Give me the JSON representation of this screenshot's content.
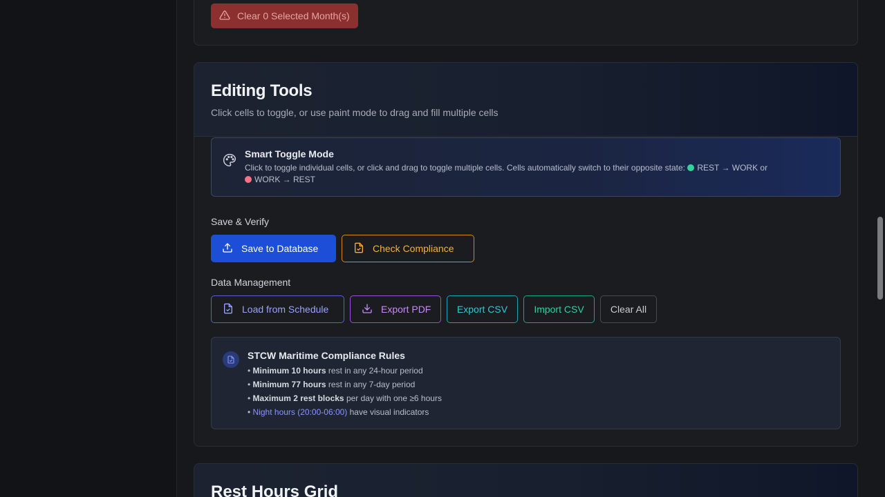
{
  "top_card": {
    "clear_months_label": "Clear 0 Selected Month(s)"
  },
  "editing_tools": {
    "title": "Editing Tools",
    "subtitle": "Click cells to toggle, or use paint mode to drag and fill multiple cells",
    "smart_toggle": {
      "title": "Smart Toggle Mode",
      "text_intro": "Click to toggle individual cells, or click and drag to toggle multiple cells. Cells automatically switch to their opposite state:",
      "rest_to_work": "REST → WORK or",
      "work_to_rest": "WORK → REST"
    },
    "save_verify": {
      "label": "Save & Verify",
      "save_button": "Save to Database",
      "check_button": "Check Compliance"
    },
    "data_management": {
      "label": "Data Management",
      "load_button": "Load from Schedule",
      "export_pdf_button": "Export PDF",
      "export_csv_button": "Export CSV",
      "import_csv_button": "Import CSV",
      "clear_all_button": "Clear All"
    },
    "rules": {
      "title": "STCW Maritime Compliance Rules",
      "items": [
        {
          "bold": "Minimum 10 hours",
          "rest": " rest in any 24-hour period"
        },
        {
          "bold": "Minimum 77 hours",
          "rest": " rest in any 7-day period"
        },
        {
          "bold": "Maximum 2 rest blocks",
          "rest": " per day with one ≥6 hours"
        },
        {
          "highlight": "Night hours (20:00-06:00)",
          "rest": " have visual indicators"
        }
      ]
    }
  },
  "rest_grid": {
    "title": "Rest Hours Grid"
  },
  "colors": {
    "primary": "#1d4ed8",
    "warning": "#f5b041",
    "rest": "#34d399",
    "work": "#f87185"
  }
}
